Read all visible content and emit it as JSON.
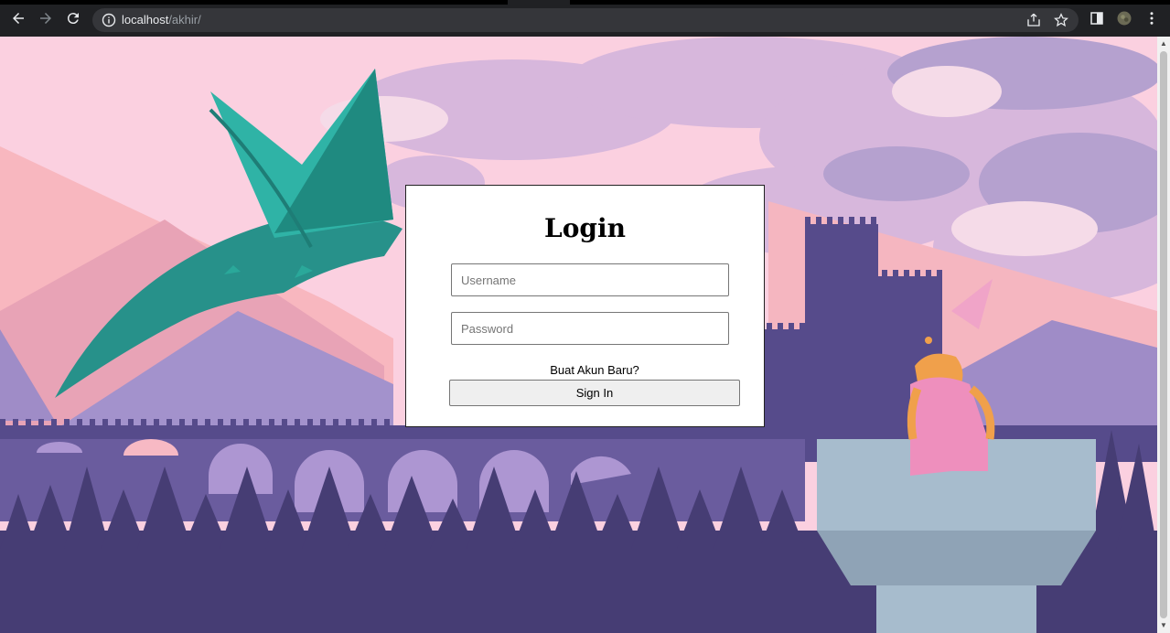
{
  "browser": {
    "url_host": "localhost",
    "url_path": "/akhir/"
  },
  "login": {
    "title": "Login",
    "username_placeholder": "Username",
    "password_placeholder": "Password",
    "new_account_link": "Buat Akun Baru?",
    "sign_in_label": "Sign In"
  },
  "colors": {
    "sky": "#fbd0e0",
    "mountain_pink": "#f9b6bd",
    "forest": "#463d74",
    "castle": "#564b8b",
    "dragon": "#2aa89a",
    "tower": "#a7bccd"
  }
}
